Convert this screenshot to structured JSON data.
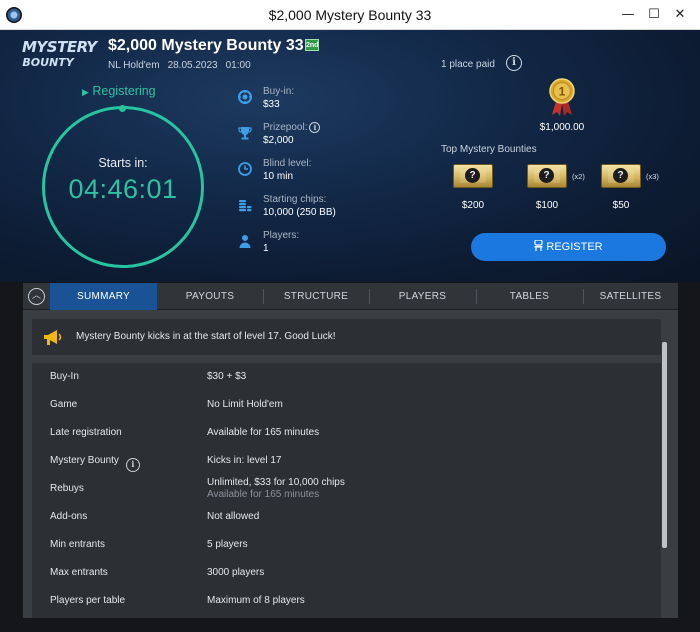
{
  "window": {
    "title": "$2,000 Mystery Bounty 33",
    "minimize_glyph": "—",
    "maximize_glyph": "☐",
    "close_glyph": "✕"
  },
  "logo": {
    "line1": "MYSTERY",
    "line2": "BOUNTY"
  },
  "tournament": {
    "name": "$2,000 Mystery Bounty 33",
    "badge": "2nd",
    "game": "NL Hold'em",
    "date": "28.05.2023",
    "time": "01:00"
  },
  "status": {
    "text": "Registering",
    "arrow": "▶"
  },
  "timer": {
    "label": "Starts in:",
    "value": "04:46:01"
  },
  "info": {
    "buyin": {
      "label": "Buy-in:",
      "value": "$33",
      "icon": "poker-chip-icon"
    },
    "prizepool": {
      "label": "Prizepool:",
      "value": "$2,000",
      "icon": "trophy-icon"
    },
    "blind": {
      "label": "Blind level:",
      "value": "10 min",
      "icon": "clock-icon"
    },
    "chips": {
      "label": "Starting chips:",
      "value": "10,000 (250 BB)",
      "icon": "chip-stack-icon"
    },
    "players": {
      "label": "Players:",
      "value": "1",
      "icon": "person-icon"
    }
  },
  "payout": {
    "places_paid": "1 place paid",
    "first_prize": "$1,000.00",
    "medal_number": "1"
  },
  "bounties": {
    "title": "Top Mystery Bounties",
    "items": [
      {
        "value": "$200",
        "mult": ""
      },
      {
        "value": "$100",
        "mult": "(x2)"
      },
      {
        "value": "$50",
        "mult": "(x3)"
      }
    ]
  },
  "register_label": "REGISTER",
  "tabs": [
    "SUMMARY",
    "PAYOUTS",
    "STRUCTURE",
    "PLAYERS",
    "TABLES",
    "SATELLITES"
  ],
  "notice": "Mystery Bounty kicks in at the start of level 17. Good Luck!",
  "summary": [
    {
      "key": "Buy-In",
      "value": "$30 + $3"
    },
    {
      "key": "Game",
      "value": "No Limit Hold'em"
    },
    {
      "key": "Late registration",
      "value": "Available for 165 minutes"
    },
    {
      "key": "Mystery Bounty",
      "value": "Kicks in: level 17"
    },
    {
      "key": "Rebuys",
      "value": "Unlimited, $33 for 10,000 chips",
      "sub": "Available for 165 minutes"
    },
    {
      "key": "Add-ons",
      "value": "Not allowed"
    },
    {
      "key": "Min entrants",
      "value": "5 players"
    },
    {
      "key": "Max entrants",
      "value": "3000 players"
    },
    {
      "key": "Players per table",
      "value": "Maximum of 8 players"
    }
  ],
  "colors": {
    "accent_teal": "#2ec2a0",
    "register_blue": "#1a78de",
    "active_tab": "#1a5296"
  }
}
